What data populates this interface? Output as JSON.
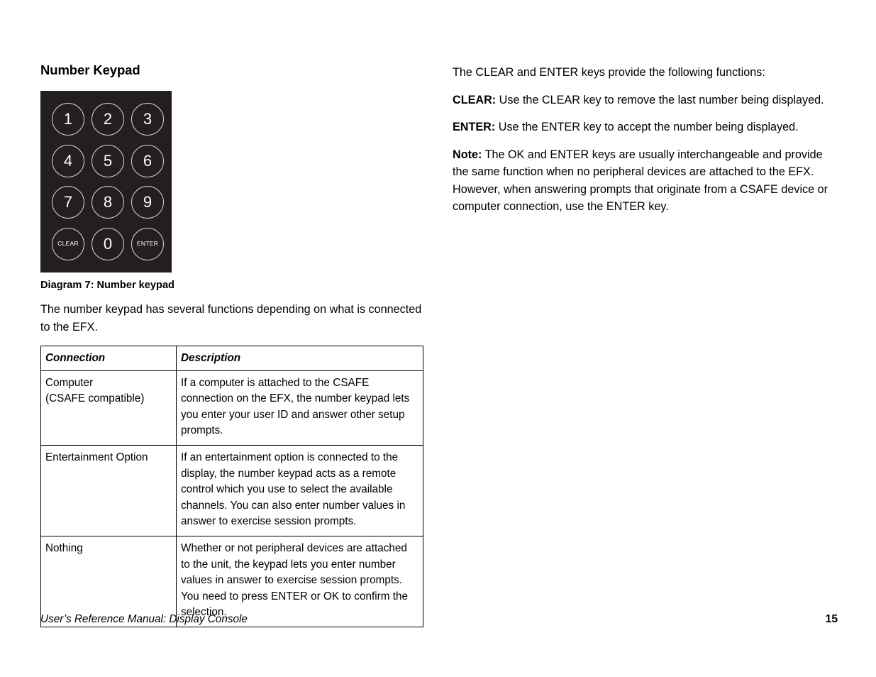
{
  "left_column": {
    "section_title": "Number Keypad",
    "keypad": {
      "panel_color": "#231f20",
      "key_outline_color": "#cfcfcf",
      "key_label_color": "#ffffff",
      "keys": [
        {
          "label": "1",
          "type": "number"
        },
        {
          "label": "2",
          "type": "number"
        },
        {
          "label": "3",
          "type": "number"
        },
        {
          "label": "4",
          "type": "number"
        },
        {
          "label": "5",
          "type": "number"
        },
        {
          "label": "6",
          "type": "number"
        },
        {
          "label": "7",
          "type": "number"
        },
        {
          "label": "8",
          "type": "number"
        },
        {
          "label": "9",
          "type": "number"
        },
        {
          "label": "CLEAR",
          "type": "word"
        },
        {
          "label": "0",
          "type": "number"
        },
        {
          "label": "ENTER",
          "type": "word"
        }
      ]
    },
    "diagram_caption": "Diagram 7: Number keypad",
    "intro_paragraph": "The number keypad has several functions depending on what is connected to the EFX.",
    "table": {
      "headers": [
        "Connection",
        "Description"
      ],
      "rows": [
        {
          "connection": "Computer\n(CSAFE compatible)",
          "description": "If a computer is attached to the CSAFE connection on the EFX, the number keypad lets you enter your user ID and answer other setup prompts."
        },
        {
          "connection": "Entertainment Option",
          "description": "If an entertainment option is connected to the display, the number keypad acts as a remote control which you use to select the available channels. You can also enter number values in answer to exercise session prompts."
        },
        {
          "connection": "Nothing",
          "description": "Whether or not peripheral devices are attached to the unit, the keypad lets you enter number values in answer to exercise session prompts. You need to press ENTER or OK to confirm the selection."
        }
      ]
    }
  },
  "right_column": {
    "intro": "The CLEAR and ENTER keys provide the following functions:",
    "clear_label": "CLEAR:",
    "clear_text": " Use the CLEAR key to remove the last number being displayed.",
    "enter_label": "ENTER:",
    "enter_text": " Use the ENTER key to accept the number being displayed.",
    "note_label": "Note:",
    "note_text": " The OK and ENTER keys are usually interchangeable and provide the same function when no peripheral devices are attached to the EFX. However, when answering prompts that originate from a CSAFE device or computer connection, use the ENTER key."
  },
  "footer": {
    "manual_title": "User’s Reference Manual: Display Console",
    "page_number": "15"
  }
}
